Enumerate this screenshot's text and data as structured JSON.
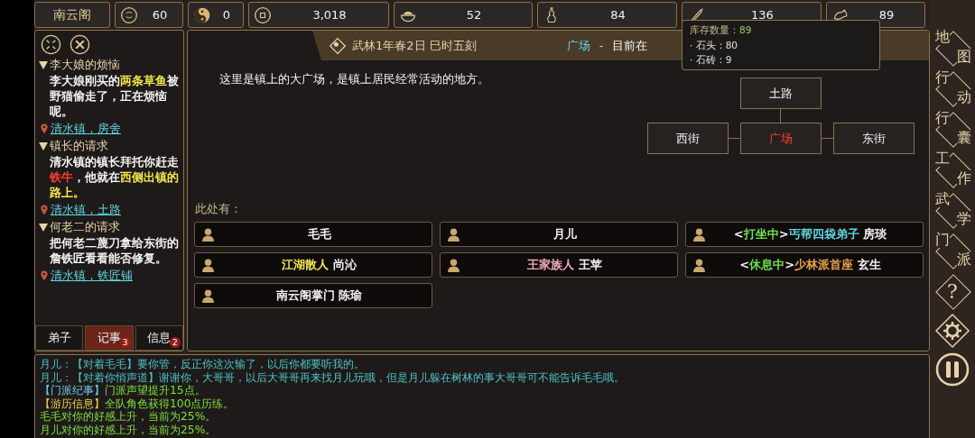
{
  "top_bar": {
    "sect": "南云阁",
    "stats": [
      {
        "kind": "emblem",
        "value": "60"
      },
      {
        "kind": "yinyang",
        "value": "0"
      },
      {
        "kind": "coin",
        "value": "3,018"
      },
      {
        "kind": "food",
        "value": "52"
      },
      {
        "kind": "gourd",
        "value": "84"
      },
      {
        "kind": "tool",
        "value": "136"
      },
      {
        "kind": "beast",
        "value": "89"
      }
    ]
  },
  "quest_panel": {
    "quests": [
      {
        "title": "李大娘的烦恼",
        "expanded": true,
        "description": [
          {
            "text": "李大娘刚买的",
            "color": "#f2f2f2"
          },
          {
            "text": "两条草鱼",
            "color": "#f2e84a"
          },
          {
            "text": "被野猫偷走了，正在烦恼呢。",
            "color": "#f2f2f2"
          }
        ],
        "location": "清水镇，房舍"
      },
      {
        "title": "镇长的请求",
        "expanded": true,
        "description": [
          {
            "text": "清水镇的镇长拜托你赶走",
            "color": "#f2f2f2"
          },
          {
            "text": "铁牛",
            "color": "#ff3b2f"
          },
          {
            "text": "，他就在",
            "color": "#f2f2f2"
          },
          {
            "text": "西侧出镇的路上。",
            "color": "#f2e84a"
          }
        ],
        "location": "清水镇，土路"
      },
      {
        "title": "何老二的请求",
        "expanded": true,
        "description": [
          {
            "text": "把何老二蔑刀拿给东街的詹铁匠看看能否修复。",
            "color": "#f2f2f2"
          }
        ],
        "location": "清水镇，铁匠铺"
      }
    ],
    "tabs": [
      {
        "label": "弟子",
        "selected": false
      },
      {
        "label": "记事",
        "selected": true,
        "badge": "3"
      },
      {
        "label": "信息",
        "selected": false,
        "badge": "2"
      }
    ]
  },
  "main": {
    "header": {
      "date": "武林1年春2日 巳时五刻",
      "location": "广场",
      "separator": "-",
      "status": "目前在"
    },
    "description": "这里是镇上的大广场，是镇上居民经常活动的地方。",
    "map": {
      "nodes": [
        {
          "label": "土路",
          "kind": "north",
          "current": false
        },
        {
          "label": "西街",
          "kind": "west",
          "current": false
        },
        {
          "label": "广场",
          "kind": "center",
          "current": true
        },
        {
          "label": "东街",
          "kind": "east",
          "current": false
        }
      ]
    },
    "presence": {
      "label": "此处有：",
      "people": [
        {
          "segments": [
            {
              "text": "毛毛",
              "color": "#f2f2f2"
            }
          ]
        },
        {
          "segments": [
            {
              "text": "月儿",
              "color": "#f2f2f2"
            }
          ]
        },
        {
          "segments": [
            {
              "text": "<",
              "color": "#f2f2f2"
            },
            {
              "text": "打坐中",
              "color": "#6fe04a"
            },
            {
              "text": ">",
              "color": "#f2f2f2"
            },
            {
              "text": "丐帮四袋弟子",
              "color": "#5fd7e0"
            },
            {
              "text": " 房琰",
              "color": "#f2f2f2"
            }
          ]
        },
        {
          "segments": [
            {
              "text": "江湖散人",
              "color": "#f2e84a"
            },
            {
              "text": " 尚沁",
              "color": "#f2f2f2"
            }
          ]
        },
        {
          "segments": [
            {
              "text": "王家族人",
              "color": "#f0a8b8"
            },
            {
              "text": " 王苹",
              "color": "#f2f2f2"
            }
          ]
        },
        {
          "segments": [
            {
              "text": "<",
              "color": "#f2f2f2"
            },
            {
              "text": "休息中",
              "color": "#6fe04a"
            },
            {
              "text": ">",
              "color": "#f2f2f2"
            },
            {
              "text": "少林派首座",
              "color": "#e8a040"
            },
            {
              "text": " 玄生",
              "color": "#f2f2f2"
            }
          ]
        },
        {
          "segments": [
            {
              "text": "南云阁掌门 陈瑜",
              "color": "#f2f2f2"
            }
          ]
        }
      ]
    }
  },
  "tooltip": {
    "title": "库存数量：",
    "total": "89",
    "lines": [
      "· 石头：80",
      "· 石砖：9"
    ]
  },
  "log": [
    {
      "segments": [
        {
          "text": "月儿：【对着毛毛】要你管，反正你这次输了，以后你都要听我的。",
          "color": "#4cc4c8"
        }
      ]
    },
    {
      "segments": [
        {
          "text": "月儿：【对着你悄声道】谢谢你，大哥哥，以后大哥哥再来找月儿玩哦，但是月儿躲在树林的事大哥哥可不能告诉毛毛哦。",
          "color": "#4cc4c8"
        }
      ]
    },
    {
      "segments": [
        {
          "text": "【门派纪事】",
          "color": "#6fd0f0"
        },
        {
          "text": "门派声望提升15点。",
          "color": "#7ee03c"
        }
      ]
    },
    {
      "segments": [
        {
          "text": "【游历信息】",
          "color": "#f0d23c"
        },
        {
          "text": "全队角色获得100点历练。",
          "color": "#7ee03c"
        }
      ]
    },
    {
      "segments": [
        {
          "text": "毛毛对你的好感上升，当前为25%。",
          "color": "#7ee03c"
        }
      ]
    },
    {
      "segments": [
        {
          "text": "月儿对你的好感上升，当前为25%。",
          "color": "#7ee03c"
        }
      ]
    }
  ],
  "sidebar": {
    "buttons": [
      {
        "kind": "text",
        "label": "地图"
      },
      {
        "kind": "text",
        "label": "行动"
      },
      {
        "kind": "text",
        "label": "行囊"
      },
      {
        "kind": "text",
        "label": "工作"
      },
      {
        "kind": "text",
        "label": "武学"
      },
      {
        "kind": "text",
        "label": "门派"
      },
      {
        "kind": "help",
        "label": "?"
      },
      {
        "kind": "settings"
      },
      {
        "kind": "pause"
      }
    ]
  }
}
